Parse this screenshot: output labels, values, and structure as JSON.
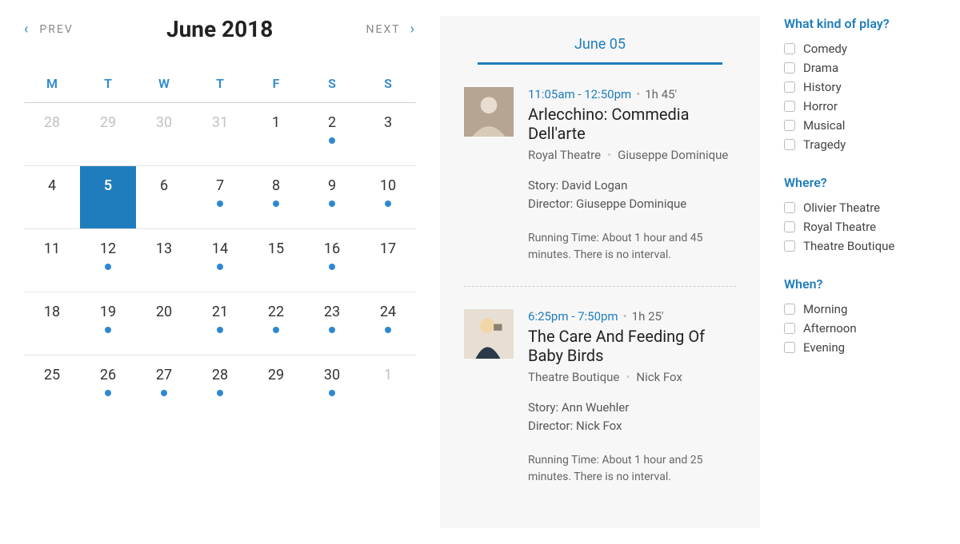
{
  "calendar": {
    "prev_label": "PREV",
    "next_label": "NEXT",
    "title": "June 2018",
    "weekdays": [
      "M",
      "T",
      "W",
      "T",
      "F",
      "S",
      "S"
    ],
    "weeks": [
      [
        {
          "n": "28",
          "muted": true,
          "dot": false,
          "sel": false
        },
        {
          "n": "29",
          "muted": true,
          "dot": false,
          "sel": false
        },
        {
          "n": "30",
          "muted": true,
          "dot": false,
          "sel": false
        },
        {
          "n": "31",
          "muted": true,
          "dot": false,
          "sel": false
        },
        {
          "n": "1",
          "muted": false,
          "dot": false,
          "sel": false
        },
        {
          "n": "2",
          "muted": false,
          "dot": true,
          "sel": false
        },
        {
          "n": "3",
          "muted": false,
          "dot": false,
          "sel": false
        }
      ],
      [
        {
          "n": "4",
          "muted": false,
          "dot": false,
          "sel": false
        },
        {
          "n": "5",
          "muted": false,
          "dot": false,
          "sel": true
        },
        {
          "n": "6",
          "muted": false,
          "dot": false,
          "sel": false
        },
        {
          "n": "7",
          "muted": false,
          "dot": true,
          "sel": false
        },
        {
          "n": "8",
          "muted": false,
          "dot": true,
          "sel": false
        },
        {
          "n": "9",
          "muted": false,
          "dot": true,
          "sel": false
        },
        {
          "n": "10",
          "muted": false,
          "dot": true,
          "sel": false
        }
      ],
      [
        {
          "n": "11",
          "muted": false,
          "dot": false,
          "sel": false
        },
        {
          "n": "12",
          "muted": false,
          "dot": true,
          "sel": false
        },
        {
          "n": "13",
          "muted": false,
          "dot": false,
          "sel": false
        },
        {
          "n": "14",
          "muted": false,
          "dot": true,
          "sel": false
        },
        {
          "n": "15",
          "muted": false,
          "dot": false,
          "sel": false
        },
        {
          "n": "16",
          "muted": false,
          "dot": true,
          "sel": false
        },
        {
          "n": "17",
          "muted": false,
          "dot": false,
          "sel": false
        }
      ],
      [
        {
          "n": "18",
          "muted": false,
          "dot": false,
          "sel": false
        },
        {
          "n": "19",
          "muted": false,
          "dot": true,
          "sel": false
        },
        {
          "n": "20",
          "muted": false,
          "dot": false,
          "sel": false
        },
        {
          "n": "21",
          "muted": false,
          "dot": true,
          "sel": false
        },
        {
          "n": "22",
          "muted": false,
          "dot": true,
          "sel": false
        },
        {
          "n": "23",
          "muted": false,
          "dot": true,
          "sel": false
        },
        {
          "n": "24",
          "muted": false,
          "dot": true,
          "sel": false
        }
      ],
      [
        {
          "n": "25",
          "muted": false,
          "dot": false,
          "sel": false
        },
        {
          "n": "26",
          "muted": false,
          "dot": true,
          "sel": false
        },
        {
          "n": "27",
          "muted": false,
          "dot": true,
          "sel": false
        },
        {
          "n": "28",
          "muted": false,
          "dot": true,
          "sel": false
        },
        {
          "n": "29",
          "muted": false,
          "dot": false,
          "sel": false
        },
        {
          "n": "30",
          "muted": false,
          "dot": true,
          "sel": false
        },
        {
          "n": "1",
          "muted": true,
          "dot": false,
          "sel": false
        }
      ]
    ]
  },
  "events_date": "June 05",
  "events": [
    {
      "time": "11:05am - 12:50pm",
      "duration": "1h 45'",
      "title": "Arlecchino: Commedia Dell'arte",
      "venue": "Royal Theatre",
      "person": "Giuseppe Dominique",
      "story_label": "Story:",
      "story": "David Logan",
      "director_label": "Director:",
      "director": "Giuseppe Dominique",
      "note": "Running Time: About 1 hour and 45 minutes. There is no interval."
    },
    {
      "time": "6:25pm - 7:50pm",
      "duration": "1h 25'",
      "title": "The Care And Feeding Of Baby Birds",
      "venue": "Theatre Boutique",
      "person": "Nick Fox",
      "story_label": "Story:",
      "story": "Ann Wuehler",
      "director_label": "Director:",
      "director": "Nick Fox",
      "note": "Running Time: About 1 hour and 25 minutes. There is no interval."
    }
  ],
  "filters": {
    "kind": {
      "title": "What kind of play?",
      "options": [
        "Comedy",
        "Drama",
        "History",
        "Horror",
        "Musical",
        "Tragedy"
      ]
    },
    "where": {
      "title": "Where?",
      "options": [
        "Olivier Theatre",
        "Royal Theatre",
        "Theatre Boutique"
      ]
    },
    "when": {
      "title": "When?",
      "options": [
        "Morning",
        "Afternoon",
        "Evening"
      ]
    }
  }
}
